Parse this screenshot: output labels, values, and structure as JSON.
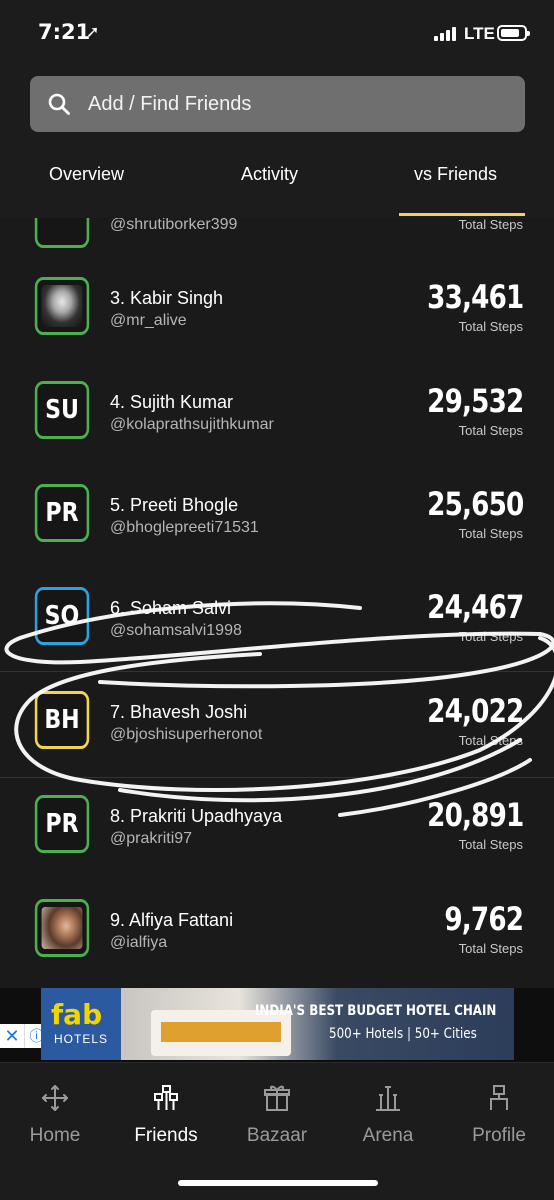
{
  "status_bar": {
    "time": "7:21",
    "network": "LTE"
  },
  "search": {
    "placeholder": "Add / Find Friends"
  },
  "tabs": [
    {
      "label": "Overview"
    },
    {
      "label": "Activity"
    },
    {
      "label": "vs Friends",
      "active": true
    }
  ],
  "leaderboard": [
    {
      "rank_name": "",
      "handle": "@shrutiborker399",
      "steps": "",
      "steps_label": "Total Steps",
      "avatar": "",
      "border": "green",
      "partial": true
    },
    {
      "rank_name": "3. Kabir Singh",
      "handle": "@mr_alive",
      "steps": "33,461",
      "steps_label": "Total Steps",
      "avatar": "",
      "border": "green",
      "photo": true
    },
    {
      "rank_name": "4. Sujith Kumar",
      "handle": "@kolaprathsujithkumar",
      "steps": "29,532",
      "steps_label": "Total Steps",
      "avatar": "SU",
      "border": "green"
    },
    {
      "rank_name": "5. Preeti Bhogle",
      "handle": "@bhoglepreeti71531",
      "steps": "25,650",
      "steps_label": "Total Steps",
      "avatar": "PR",
      "border": "green"
    },
    {
      "rank_name": "6. Soham Salvi",
      "handle": "@sohamsalvi1998",
      "steps": "24,467",
      "steps_label": "Total Steps",
      "avatar": "SO",
      "border": "blue"
    },
    {
      "rank_name": "7. Bhavesh Joshi",
      "handle": "@bjoshisuperheronot",
      "steps": "24,022",
      "steps_label": "Total Steps",
      "avatar": "BH",
      "border": "yellow"
    },
    {
      "rank_name": "8. Prakriti Upadhyaya",
      "handle": "@prakriti97",
      "steps": "20,891",
      "steps_label": "Total Steps",
      "avatar": "PR",
      "border": "green"
    },
    {
      "rank_name": "9. Alfiya Fattani",
      "handle": "@ialfiya",
      "steps": "9,762",
      "steps_label": "Total Steps",
      "avatar": "",
      "border": "green",
      "photo": true
    }
  ],
  "ad": {
    "logo_main": "fab",
    "logo_sub": "HOTELS",
    "headline": "INDIA'S BEST BUDGET HOTEL CHAIN",
    "subline": "500+ Hotels | 50+ Cities"
  },
  "bottom_nav": [
    {
      "label": "Home",
      "icon": "home-icon"
    },
    {
      "label": "Friends",
      "icon": "friends-icon",
      "active": true
    },
    {
      "label": "Bazaar",
      "icon": "bazaar-icon"
    },
    {
      "label": "Arena",
      "icon": "arena-icon"
    },
    {
      "label": "Profile",
      "icon": "profile-icon"
    }
  ]
}
